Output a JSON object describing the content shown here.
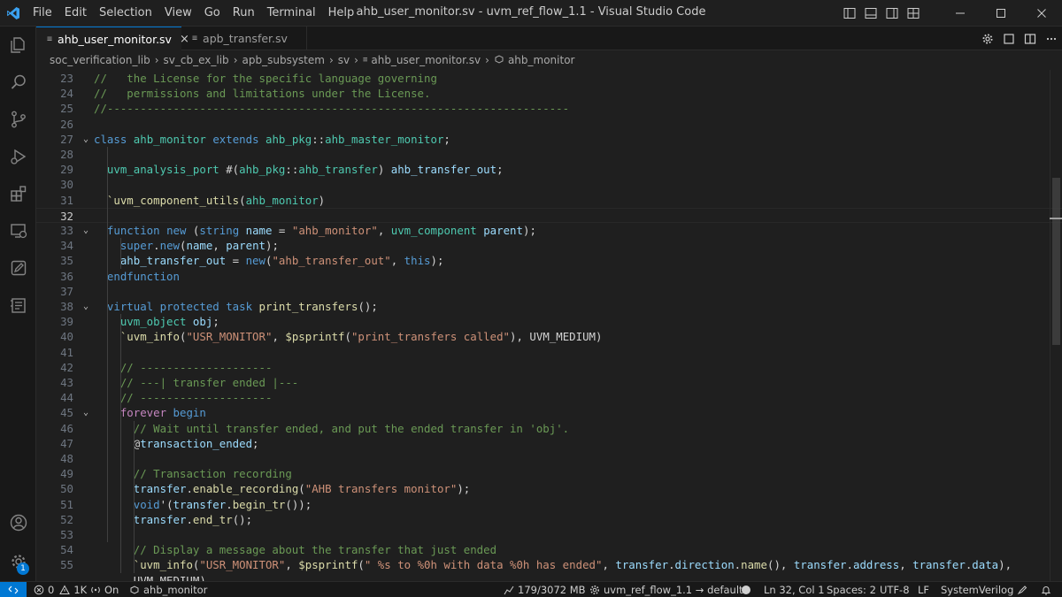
{
  "menu": [
    "File",
    "Edit",
    "Selection",
    "View",
    "Go",
    "Run",
    "Terminal",
    "Help"
  ],
  "window_title": "ahb_user_monitor.sv - uvm_ref_flow_1.1 - Visual Studio Code",
  "tabs": [
    {
      "label": "ahb_user_monitor.sv",
      "active": true
    },
    {
      "label": "apb_transfer.sv",
      "active": false
    }
  ],
  "breadcrumbs": [
    "soc_verification_lib",
    "sv_cb_ex_lib",
    "apb_subsystem",
    "sv",
    "ahb_user_monitor.sv",
    "ahb_monitor"
  ],
  "editor": {
    "current_line": 32,
    "lines": [
      {
        "n": "23",
        "fold": false,
        "html": "<span class=\"c\">//   the License for the specific language governing</span>"
      },
      {
        "n": "24",
        "fold": false,
        "html": "<span class=\"c\">//   permissions and limitations under the License.</span>"
      },
      {
        "n": "25",
        "fold": false,
        "html": "<span class=\"c\">//----------------------------------------------------------------------</span>"
      },
      {
        "n": "26",
        "fold": false,
        "html": ""
      },
      {
        "n": "27",
        "fold": true,
        "html": "<span class=\"k\">class</span> <span class=\"t\">ahb_monitor</span> <span class=\"k\">extends</span> <span class=\"t\">ahb_pkg</span>::<span class=\"t\">ahb_master_monitor</span>;"
      },
      {
        "n": "28",
        "fold": false,
        "html": ""
      },
      {
        "n": "29",
        "fold": false,
        "html": "  <span class=\"t\">uvm_analysis_port</span> #(<span class=\"t\">ahb_pkg</span>::<span class=\"t\">ahb_transfer</span>) <span class=\"v\">ahb_transfer_out</span>;"
      },
      {
        "n": "30",
        "fold": false,
        "html": ""
      },
      {
        "n": "31",
        "fold": false,
        "html": "  <span class=\"f\">`uvm_component_utils</span>(<span class=\"t\">ahb_monitor</span>)"
      },
      {
        "n": "32",
        "fold": false,
        "html": ""
      },
      {
        "n": "33",
        "fold": true,
        "html": "  <span class=\"k\">function</span> <span class=\"k\">new</span> (<span class=\"k\">string</span> <span class=\"v\">name</span> = <span class=\"s\">\"ahb_monitor\"</span>, <span class=\"t\">uvm_component</span> <span class=\"v\">parent</span>);"
      },
      {
        "n": "34",
        "fold": false,
        "html": "    <span class=\"k\">super</span>.<span class=\"k\">new</span>(<span class=\"v\">name</span>, <span class=\"v\">parent</span>);"
      },
      {
        "n": "35",
        "fold": false,
        "html": "    <span class=\"v\">ahb_transfer_out</span> = <span class=\"k\">new</span>(<span class=\"s\">\"ahb_transfer_out\"</span>, <span class=\"k\">this</span>);"
      },
      {
        "n": "36",
        "fold": false,
        "html": "  <span class=\"k\">endfunction</span>"
      },
      {
        "n": "37",
        "fold": false,
        "html": ""
      },
      {
        "n": "38",
        "fold": true,
        "html": "  <span class=\"k\">virtual</span> <span class=\"k\">protected</span> <span class=\"k\">task</span> <span class=\"f\">print_transfers</span>();"
      },
      {
        "n": "39",
        "fold": false,
        "html": "    <span class=\"t\">uvm_object</span> <span class=\"v\">obj</span>;"
      },
      {
        "n": "40",
        "fold": false,
        "html": "    <span class=\"f\">`uvm_info</span>(<span class=\"s\">\"USR_MONITOR\"</span>, <span class=\"f\">$psprintf</span>(<span class=\"s\">\"print_transfers called\"</span>), UVM_MEDIUM)"
      },
      {
        "n": "41",
        "fold": false,
        "html": ""
      },
      {
        "n": "42",
        "fold": false,
        "html": "    <span class=\"c\">// --------------------</span>"
      },
      {
        "n": "43",
        "fold": false,
        "html": "    <span class=\"c\">// ---| transfer ended |---</span>"
      },
      {
        "n": "44",
        "fold": false,
        "html": "    <span class=\"c\">// --------------------</span>"
      },
      {
        "n": "45",
        "fold": true,
        "html": "    <span class=\"p\">forever</span> <span class=\"k\">begin</span>"
      },
      {
        "n": "46",
        "fold": false,
        "html": "      <span class=\"c\">// Wait until transfer ended, and put the ended transfer in 'obj'.</span>"
      },
      {
        "n": "47",
        "fold": false,
        "html": "      @<span class=\"v\">transaction_ended</span>;"
      },
      {
        "n": "48",
        "fold": false,
        "html": ""
      },
      {
        "n": "49",
        "fold": false,
        "html": "      <span class=\"c\">// Transaction recording</span>"
      },
      {
        "n": "50",
        "fold": false,
        "html": "      <span class=\"v\">transfer</span>.<span class=\"f\">enable_recording</span>(<span class=\"s\">\"AHB transfers monitor\"</span>);"
      },
      {
        "n": "51",
        "fold": false,
        "html": "      <span class=\"k\">void</span>'(<span class=\"v\">transfer</span>.<span class=\"f\">begin_tr</span>());"
      },
      {
        "n": "52",
        "fold": false,
        "html": "      <span class=\"v\">transfer</span>.<span class=\"f\">end_tr</span>();"
      },
      {
        "n": "53",
        "fold": false,
        "html": ""
      },
      {
        "n": "54",
        "fold": false,
        "html": "      <span class=\"c\">// Display a message about the transfer that just ended</span>"
      },
      {
        "n": "55",
        "fold": false,
        "html": "      <span class=\"f\">`uvm_info</span>(<span class=\"s\">\"USR_MONITOR\"</span>, <span class=\"f\">$psprintf</span>(<span class=\"s\">\" %s to %0h with data %0h has ended\"</span>, <span class=\"v\">transfer</span>.<span class=\"v\">direction</span>.<span class=\"f\">name</span>(), <span class=\"v\">transfer</span>.<span class=\"v\">address</span>, <span class=\"v\">transfer</span>.<span class=\"v\">data</span>),"
      },
      {
        "n": "",
        "fold": false,
        "html": "      UVM_MEDIUM)"
      }
    ]
  },
  "status": {
    "problems": "0",
    "warnings": "1K",
    "on": "On",
    "scope": "ahb_monitor",
    "memory": "179/3072 MB",
    "workspace": "uvm_ref_flow_1.1 → default",
    "position": "Ln 32, Col 1",
    "spaces": "Spaces: 2",
    "encoding": "UTF-8",
    "eol": "LF",
    "language": "SystemVerilog",
    "settings_badge": "1"
  },
  "colors": {
    "accent": "#0078d4",
    "background": "#1f1f1f",
    "sidebar": "#181818"
  }
}
